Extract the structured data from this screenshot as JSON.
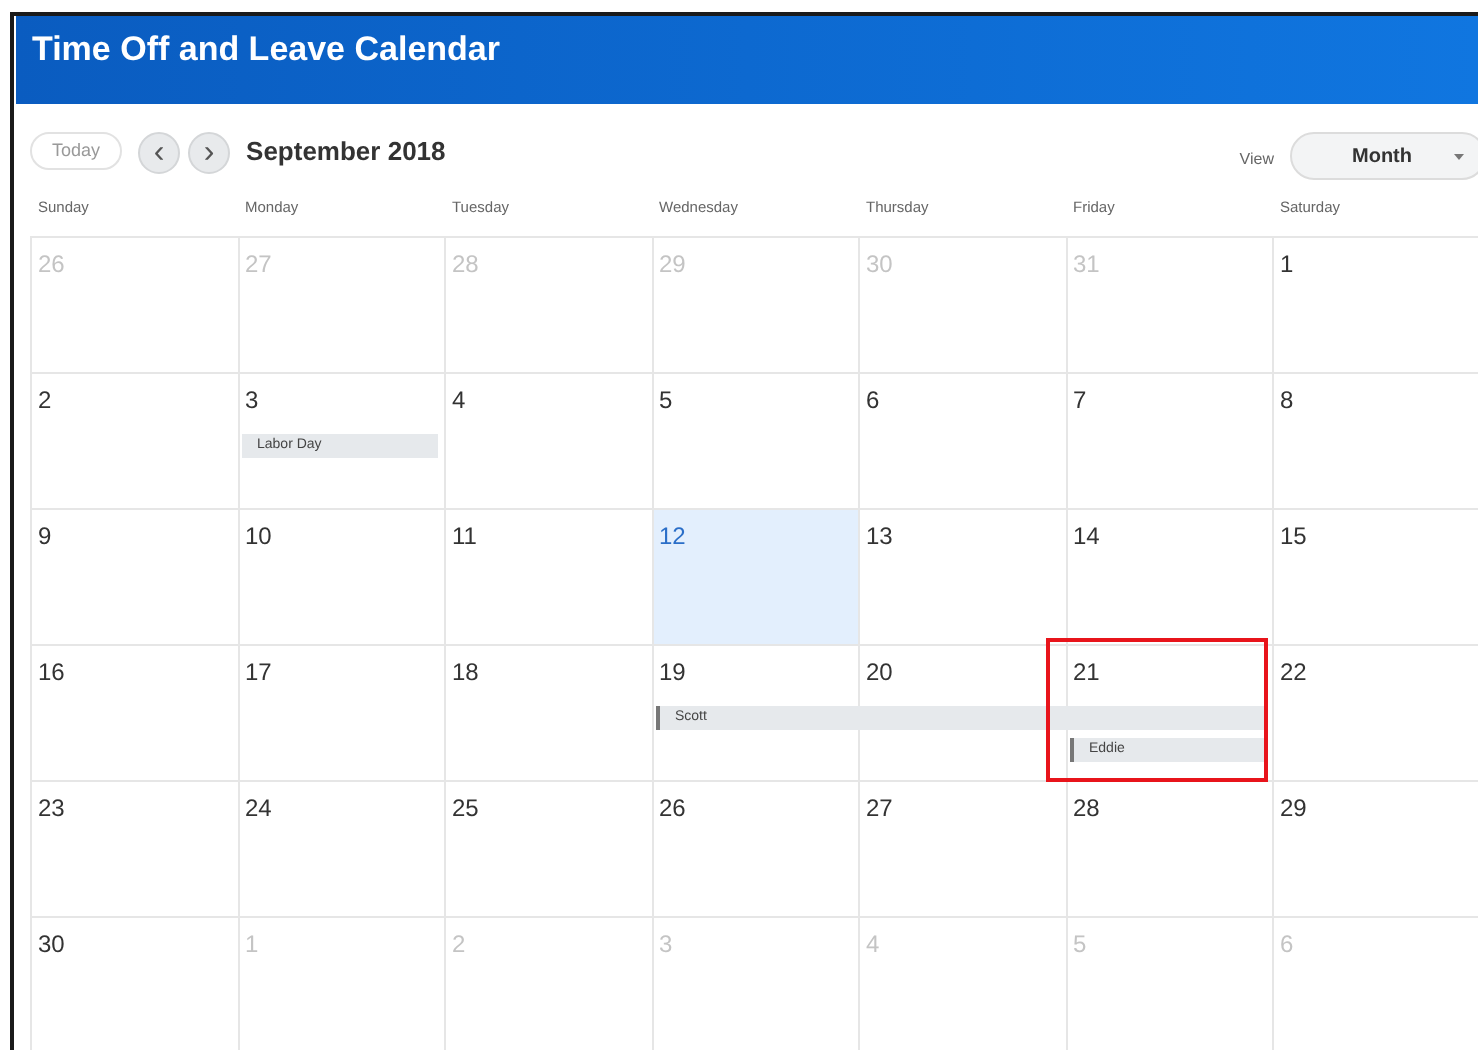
{
  "header": {
    "title": "Time Off and Leave Calendar"
  },
  "toolbar": {
    "today_button": "Today",
    "prev_button": "‹",
    "next_button": "›",
    "period": "September 2018",
    "view_label": "View",
    "view_select": "Month"
  },
  "weekdays": [
    "Sunday",
    "Monday",
    "Tuesday",
    "Wednesday",
    "Thursday",
    "Friday",
    "Saturday"
  ],
  "weeks": [
    [
      {
        "day": "26",
        "in_month": false,
        "today": false,
        "highlighted": false
      },
      {
        "day": "27",
        "in_month": false,
        "today": false,
        "highlighted": false
      },
      {
        "day": "28",
        "in_month": false,
        "today": false,
        "highlighted": false
      },
      {
        "day": "29",
        "in_month": false,
        "today": false,
        "highlighted": false
      },
      {
        "day": "30",
        "in_month": false,
        "today": false,
        "highlighted": false
      },
      {
        "day": "31",
        "in_month": false,
        "today": false,
        "highlighted": false
      },
      {
        "day": "1",
        "in_month": true,
        "today": false,
        "highlighted": false
      }
    ],
    [
      {
        "day": "2",
        "in_month": true,
        "today": false,
        "highlighted": false
      },
      {
        "day": "3",
        "in_month": true,
        "today": false,
        "highlighted": false,
        "events": [
          {
            "kind": "holiday",
            "label": "Labor Day"
          }
        ]
      },
      {
        "day": "4",
        "in_month": true,
        "today": false,
        "highlighted": false
      },
      {
        "day": "5",
        "in_month": true,
        "today": false,
        "highlighted": false
      },
      {
        "day": "6",
        "in_month": true,
        "today": false,
        "highlighted": false
      },
      {
        "day": "7",
        "in_month": true,
        "today": false,
        "highlighted": false
      },
      {
        "day": "8",
        "in_month": true,
        "today": false,
        "highlighted": false
      }
    ],
    [
      {
        "day": "9",
        "in_month": true,
        "today": false,
        "highlighted": false
      },
      {
        "day": "10",
        "in_month": true,
        "today": false,
        "highlighted": false
      },
      {
        "day": "11",
        "in_month": true,
        "today": false,
        "highlighted": false
      },
      {
        "day": "12",
        "in_month": true,
        "today": true,
        "highlighted": false
      },
      {
        "day": "13",
        "in_month": true,
        "today": false,
        "highlighted": false
      },
      {
        "day": "14",
        "in_month": true,
        "today": false,
        "highlighted": false
      },
      {
        "day": "15",
        "in_month": true,
        "today": false,
        "highlighted": false
      }
    ],
    [
      {
        "day": "16",
        "in_month": true,
        "today": false,
        "highlighted": false
      },
      {
        "day": "17",
        "in_month": true,
        "today": false,
        "highlighted": false
      },
      {
        "day": "18",
        "in_month": true,
        "today": false,
        "highlighted": false
      },
      {
        "day": "19",
        "in_month": true,
        "today": false,
        "highlighted": false,
        "events": [
          {
            "kind": "time_off",
            "label": "Scott"
          }
        ]
      },
      {
        "day": "20",
        "in_month": true,
        "today": false,
        "highlighted": false,
        "events": [
          {
            "kind": "continue"
          }
        ]
      },
      {
        "day": "21",
        "in_month": true,
        "today": false,
        "highlighted": true,
        "events": [
          {
            "kind": "continue"
          },
          {
            "kind": "time_off",
            "label": "Eddie"
          }
        ]
      },
      {
        "day": "22",
        "in_month": true,
        "today": false,
        "highlighted": false
      }
    ],
    [
      {
        "day": "23",
        "in_month": true,
        "today": false,
        "highlighted": false
      },
      {
        "day": "24",
        "in_month": true,
        "today": false,
        "highlighted": false
      },
      {
        "day": "25",
        "in_month": true,
        "today": false,
        "highlighted": false
      },
      {
        "day": "26",
        "in_month": true,
        "today": false,
        "highlighted": false
      },
      {
        "day": "27",
        "in_month": true,
        "today": false,
        "highlighted": false
      },
      {
        "day": "28",
        "in_month": true,
        "today": false,
        "highlighted": false
      },
      {
        "day": "29",
        "in_month": true,
        "today": false,
        "highlighted": false
      }
    ],
    [
      {
        "day": "30",
        "in_month": true,
        "today": false,
        "highlighted": false
      },
      {
        "day": "1",
        "in_month": false,
        "today": false,
        "highlighted": false
      },
      {
        "day": "2",
        "in_month": false,
        "today": false,
        "highlighted": false
      },
      {
        "day": "3",
        "in_month": false,
        "today": false,
        "highlighted": false
      },
      {
        "day": "4",
        "in_month": false,
        "today": false,
        "highlighted": false
      },
      {
        "day": "5",
        "in_month": false,
        "today": false,
        "highlighted": false
      },
      {
        "day": "6",
        "in_month": false,
        "today": false,
        "highlighted": false
      }
    ]
  ]
}
